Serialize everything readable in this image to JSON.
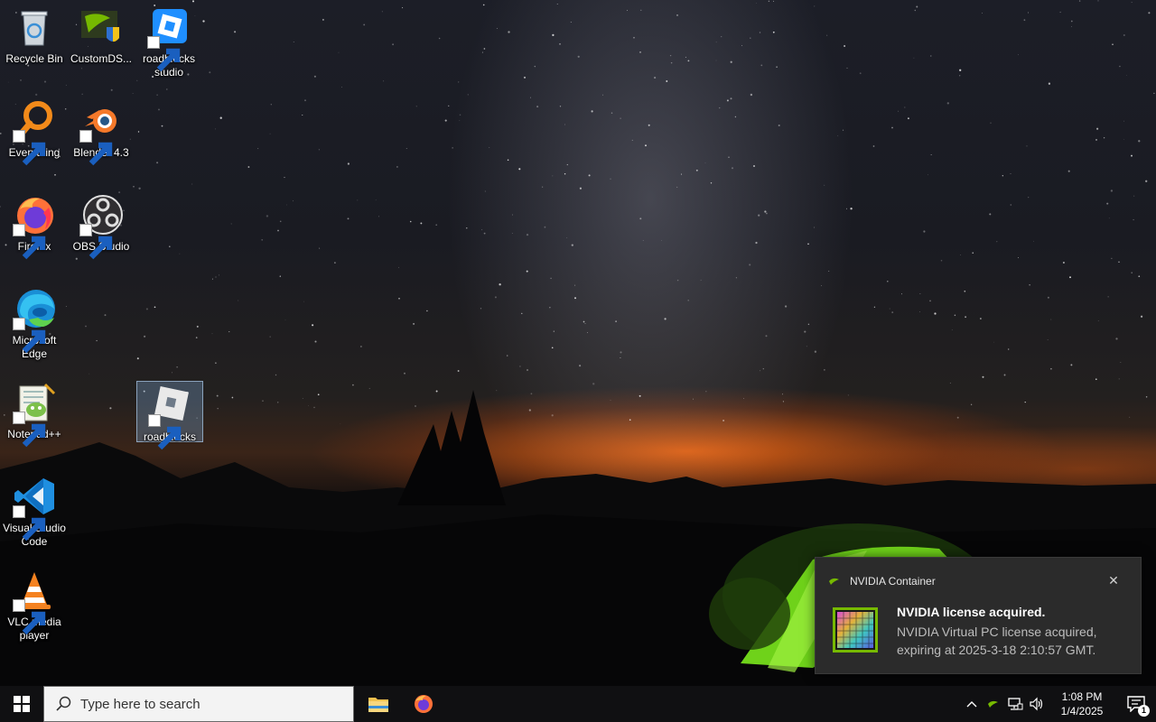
{
  "desktop": {
    "icons": [
      {
        "label": "Recycle Bin",
        "icon": "recycle-bin-icon"
      },
      {
        "label": "CustomDS...",
        "icon": "customds-icon"
      },
      {
        "label": "roadblocks studio",
        "icon": "roadblocks-studio-icon"
      },
      {
        "label": "Everything",
        "icon": "everything-search-icon"
      },
      {
        "label": "Blender 4.3",
        "icon": "blender-icon"
      },
      {
        "label": "Firefox",
        "icon": "firefox-icon"
      },
      {
        "label": "OBS Studio",
        "icon": "obs-studio-icon"
      },
      {
        "label": "Microsoft Edge",
        "icon": "edge-icon"
      },
      {
        "label": "Notepad++",
        "icon": "notepad-plus-plus-icon"
      },
      {
        "label": "roadblocks",
        "icon": "roadblocks-icon",
        "selected": true
      },
      {
        "label": "Visual Studio Code",
        "icon": "vscode-icon"
      },
      {
        "label": "VLC media player",
        "icon": "vlc-icon"
      }
    ]
  },
  "notification": {
    "app_name": "NVIDIA Container",
    "title": "NVIDIA license acquired.",
    "body": "NVIDIA Virtual PC license acquired, expiring at 2025-3-18 2:10:57 GMT.",
    "close_glyph": "✕"
  },
  "taskbar": {
    "search_placeholder": "Type here to search",
    "pinned": [
      {
        "name": "File Explorer",
        "icon": "file-explorer-icon"
      },
      {
        "name": "Firefox",
        "icon": "firefox-icon"
      }
    ],
    "tray": {
      "chevron": "^",
      "time": "1:08 PM",
      "date": "1/4/2025",
      "notification_count": "1"
    }
  },
  "colors": {
    "nvidia_green": "#76b900",
    "taskbar_bg": "#101012",
    "toast_bg": "#2b2b2b"
  }
}
